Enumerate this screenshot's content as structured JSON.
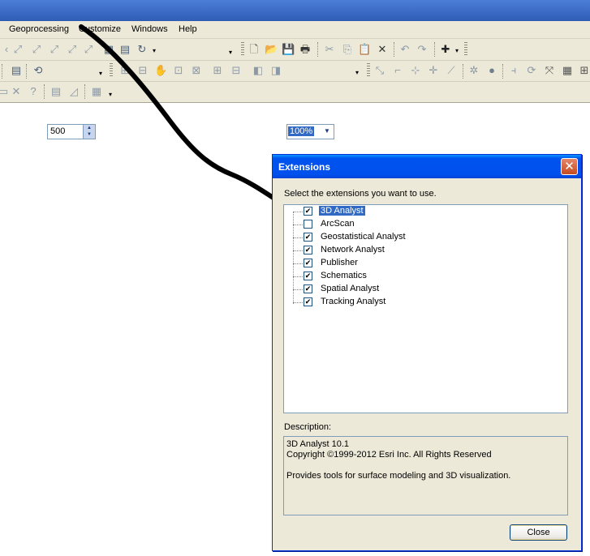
{
  "menubar": {
    "items": [
      "Geoprocessing",
      "Customize",
      "Windows",
      "Help"
    ]
  },
  "toolbar": {
    "spin_value": "500",
    "zoom_value": "100%"
  },
  "dialog": {
    "title": "Extensions",
    "close_glyph": "✕",
    "prompt": "Select the extensions you want to use.",
    "extensions": [
      {
        "label": "3D Analyst",
        "checked": true,
        "selected": true
      },
      {
        "label": "ArcScan",
        "checked": false,
        "selected": false
      },
      {
        "label": "Geostatistical Analyst",
        "checked": true,
        "selected": false
      },
      {
        "label": "Network Analyst",
        "checked": true,
        "selected": false
      },
      {
        "label": "Publisher",
        "checked": true,
        "selected": false
      },
      {
        "label": "Schematics",
        "checked": true,
        "selected": false
      },
      {
        "label": "Spatial Analyst",
        "checked": true,
        "selected": false
      },
      {
        "label": "Tracking Analyst",
        "checked": true,
        "selected": false
      }
    ],
    "description_label": "Description:",
    "description": {
      "line1": "3D Analyst 10.1",
      "line2": "Copyright ©1999-2012 Esri Inc. All Rights Reserved",
      "line3": "Provides tools for surface modeling and 3D visualization."
    },
    "close_label": "Close"
  },
  "colors": {
    "selection": "#316ac5",
    "xp_title_blue": "#0053ee",
    "window_face": "#ece9d8"
  }
}
